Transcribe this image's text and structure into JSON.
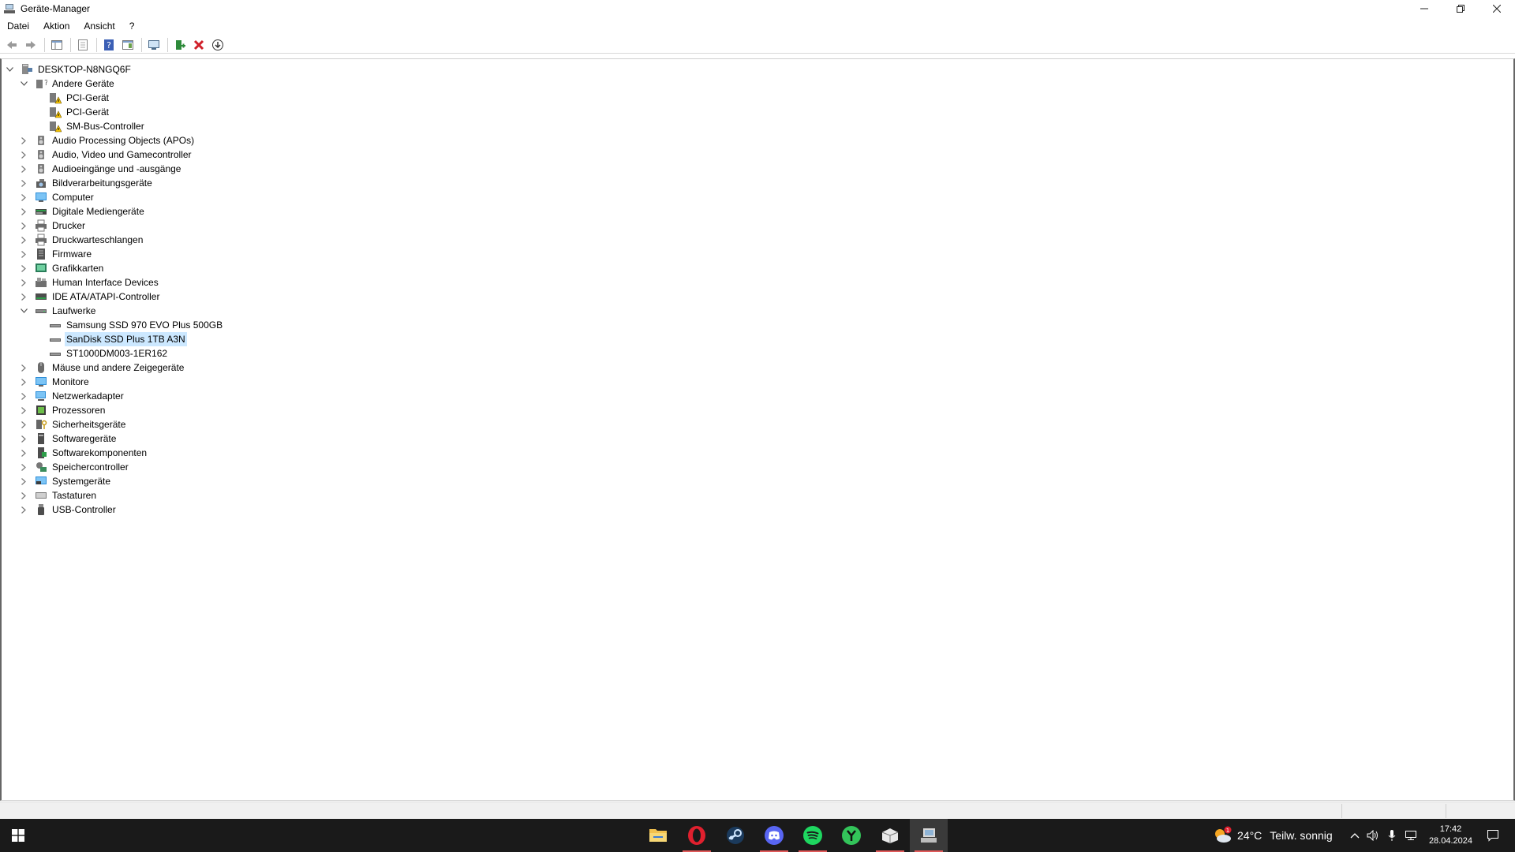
{
  "window": {
    "title": "Geräte-Manager",
    "controls": {
      "minimize": "—",
      "restore": "❐",
      "close": "✕"
    }
  },
  "menu": [
    "Datei",
    "Aktion",
    "Ansicht",
    "?"
  ],
  "toolbar": {
    "buttons": [
      "back-arrow-icon",
      "forward-arrow-icon",
      "show-hide-console-tree-icon",
      "properties-icon",
      "help-icon",
      "action-pane-icon",
      "scan-hardware-icon",
      "add-driver-icon",
      "uninstall-icon",
      "update-driver-icon"
    ]
  },
  "tree": {
    "root": "DESKTOP-N8NGQ6F",
    "categories": [
      {
        "label": "Andere Geräte",
        "expanded": true,
        "icon": "unknown-device-icon",
        "children": [
          "PCI-Gerät",
          "PCI-Gerät",
          "SM-Bus-Controller"
        ]
      },
      {
        "label": "Audio Processing Objects (APOs)",
        "expanded": false,
        "icon": "speaker-icon"
      },
      {
        "label": "Audio, Video und Gamecontroller",
        "expanded": false,
        "icon": "speaker-icon"
      },
      {
        "label": "Audioeingänge und -ausgänge",
        "expanded": false,
        "icon": "speaker-icon"
      },
      {
        "label": "Bildverarbeitungsgeräte",
        "expanded": false,
        "icon": "camera-icon"
      },
      {
        "label": "Computer",
        "expanded": false,
        "icon": "monitor-icon"
      },
      {
        "label": "Digitale Mediengeräte",
        "expanded": false,
        "icon": "media-device-icon"
      },
      {
        "label": "Drucker",
        "expanded": false,
        "icon": "printer-icon"
      },
      {
        "label": "Druckwarteschlangen",
        "expanded": false,
        "icon": "printer-icon"
      },
      {
        "label": "Firmware",
        "expanded": false,
        "icon": "firmware-icon"
      },
      {
        "label": "Grafikkarten",
        "expanded": false,
        "icon": "display-adapter-icon"
      },
      {
        "label": "Human Interface Devices",
        "expanded": false,
        "icon": "hid-icon"
      },
      {
        "label": "IDE ATA/ATAPI-Controller",
        "expanded": false,
        "icon": "ide-controller-icon"
      },
      {
        "label": "Laufwerke",
        "expanded": true,
        "icon": "drive-icon",
        "children": [
          "Samsung SSD 970 EVO Plus 500GB",
          "SanDisk SSD Plus 1TB A3N",
          "ST1000DM003-1ER162"
        ],
        "selected_child": 1
      },
      {
        "label": "Mäuse und andere Zeigegeräte",
        "expanded": false,
        "icon": "mouse-icon"
      },
      {
        "label": "Monitore",
        "expanded": false,
        "icon": "monitor-icon"
      },
      {
        "label": "Netzwerkadapter",
        "expanded": false,
        "icon": "network-adapter-icon"
      },
      {
        "label": "Prozessoren",
        "expanded": false,
        "icon": "processor-icon"
      },
      {
        "label": "Sicherheitsgeräte",
        "expanded": false,
        "icon": "security-device-icon"
      },
      {
        "label": "Softwaregeräte",
        "expanded": false,
        "icon": "software-device-icon"
      },
      {
        "label": "Softwarekomponenten",
        "expanded": false,
        "icon": "software-component-icon"
      },
      {
        "label": "Speichercontroller",
        "expanded": false,
        "icon": "storage-controller-icon"
      },
      {
        "label": "Systemgeräte",
        "expanded": false,
        "icon": "system-device-icon"
      },
      {
        "label": "Tastaturen",
        "expanded": false,
        "icon": "keyboard-icon"
      },
      {
        "label": "USB-Controller",
        "expanded": false,
        "icon": "usb-icon"
      }
    ]
  },
  "taskbar": {
    "apps": [
      "file-explorer-icon",
      "opera-icon",
      "steam-icon",
      "discord-icon",
      "spotify-icon",
      "app-green-icon",
      "app-box-icon",
      "device-manager-icon"
    ],
    "weather": {
      "temp": "24°C",
      "desc": "Teilw. sonnig",
      "badge": "1"
    },
    "time": "17:42",
    "date": "28.04.2024"
  }
}
